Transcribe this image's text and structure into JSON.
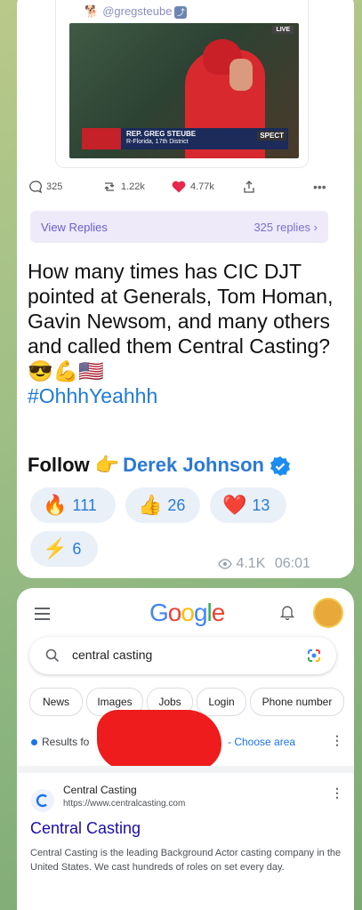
{
  "tweet": {
    "handle": "@gregsteube",
    "video": {
      "live_label": "LIVE",
      "chyron_name": "REP. GREG STEUBE",
      "chyron_sub": "R-Florida, 17th District",
      "network": "SPECT"
    }
  },
  "stats": {
    "replies": "325",
    "retweets": "1.22k",
    "likes": "4.77k"
  },
  "view_replies": {
    "label": "View Replies",
    "count": "325 replies ›"
  },
  "post": {
    "text": "How many times has CIC DJT pointed at Generals, Tom Homan, Gavin Newsom, and many others and called them Central Casting? 😎💪🇺🇸",
    "hashtag": "#OhhhYeahhh",
    "follow_label": "Follow",
    "follow_emoji": "👉",
    "follow_name": "Derek Johnson"
  },
  "reactions": [
    {
      "emoji": "🔥",
      "count": "111"
    },
    {
      "emoji": "👍",
      "count": "26"
    },
    {
      "emoji": "❤️",
      "count": "13"
    },
    {
      "emoji": "⚡",
      "count": "6"
    }
  ],
  "meta": {
    "views": "4.1K",
    "time": "06:01"
  },
  "google": {
    "logo": "Google",
    "query": "central casting",
    "chips": [
      "News",
      "Images",
      "Jobs",
      "Login",
      "Phone number"
    ],
    "results_prefix": "Results fo",
    "choose_area": "- Choose area",
    "result": {
      "site": "Central Casting",
      "url": "https://www.centralcasting.com",
      "title": "Central Casting",
      "description": "Central Casting is the leading Background Actor casting company in the United States. We cast hundreds of roles on set every day."
    }
  },
  "colors": {
    "accent": "#6b5fc9",
    "link": "#1a0dab",
    "hashtag": "#1f7ad6",
    "like": "#e8274b"
  }
}
